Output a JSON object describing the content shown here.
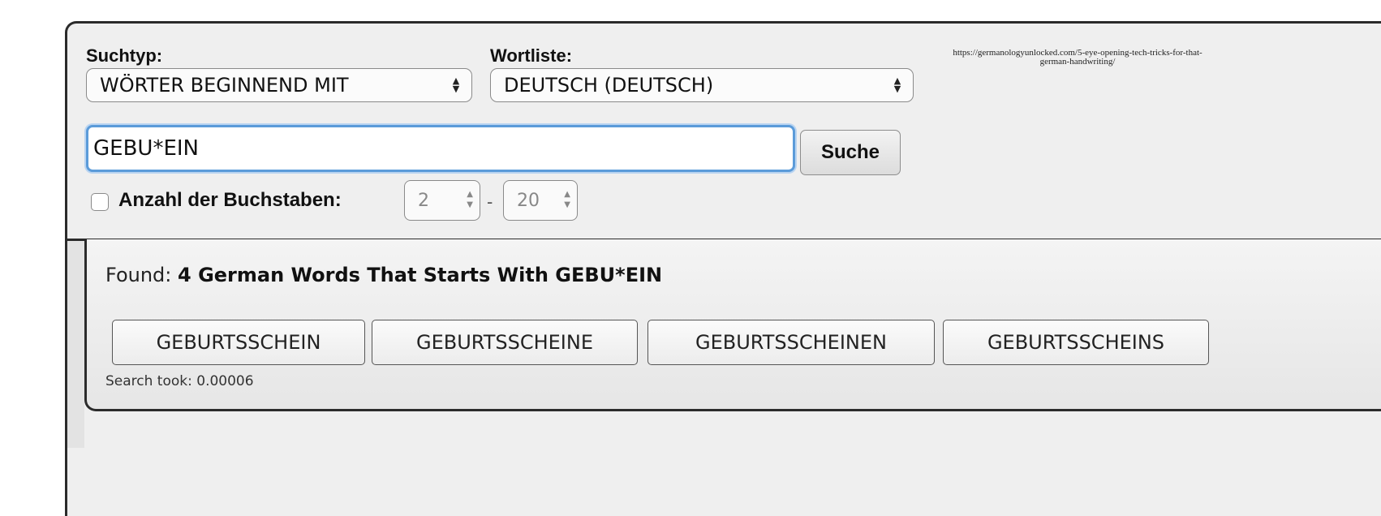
{
  "form": {
    "search_type_label": "Suchtyp:",
    "search_type_value": "WÖRTER BEGINNEND MIT",
    "word_list_label": "Wortliste:",
    "word_list_value": "DEUTSCH (DEUTSCH)",
    "query_value": "GEBU*EIN",
    "search_button": "Suche",
    "letter_count_label": "Anzahl der Buchstaben:",
    "letter_count_checked": false,
    "min_letters": "2",
    "range_separator": "-",
    "max_letters": "20"
  },
  "source_note": "https://germanologyunlocked.com/5-eye-opening-tech-tricks-for-that-german-handwriting/",
  "results": {
    "found_prefix": "Found:",
    "found_text": "4 German Words That Starts With GEBU*EIN",
    "words": [
      "GEBURTSSCHEIN",
      "GEBURTSSCHEINE",
      "GEBURTSSCHEINEN",
      "GEBURTSSCHEINS"
    ],
    "search_took": "Search took: 0.00006"
  },
  "colors": {
    "panel_background": "#efefef",
    "input_focus_border": "#5b9bd9",
    "frame_border": "#2b2b2b"
  },
  "icons": {
    "select_arrows": "up-down-chevron-icon",
    "stepper_arrows": "up-down-chevron-icon"
  }
}
